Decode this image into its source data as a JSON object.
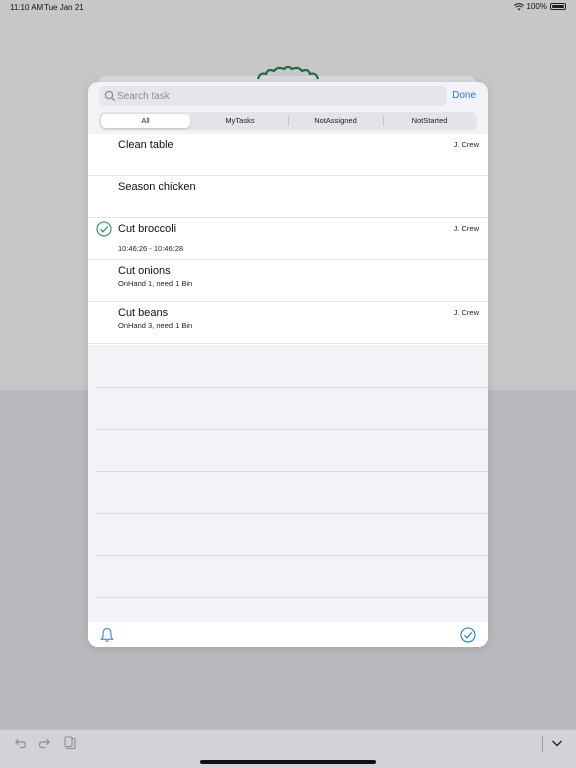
{
  "status_bar": {
    "time": "11:10 AM",
    "date": "Tue Jan 21",
    "battery": "100%"
  },
  "search": {
    "placeholder": "Search task",
    "done_label": "Done"
  },
  "filters": {
    "tabs": [
      "All",
      "MyTasks",
      "NotAssigned",
      "NotStarted"
    ],
    "selected": "All"
  },
  "tasks": [
    {
      "title": "Clean table",
      "subtitle": "",
      "assignee": "J. Crew",
      "completed": false
    },
    {
      "title": "Season chicken",
      "subtitle": "",
      "assignee": "",
      "completed": false
    },
    {
      "title": "Cut broccoli",
      "subtitle": "10:46:26 - 10:46:28",
      "assignee": "J. Crew",
      "completed": true
    },
    {
      "title": "Cut onions",
      "subtitle": "OnHand 1, need 1 Bin",
      "assignee": "",
      "completed": false
    },
    {
      "title": "Cut beans",
      "subtitle": "OnHand 3, need 1 Bin",
      "assignee": "J. Crew",
      "completed": false
    }
  ],
  "icons": {
    "footer_left": "bell-icon",
    "footer_right": "checkmark-circle-icon",
    "toolbar": [
      "undo-icon",
      "redo-icon",
      "clipboard-icon",
      "chevron-down-icon"
    ]
  },
  "colors": {
    "accent": "#1d7ae0",
    "completed_check": "#2e8b57",
    "logo": "#1f6b3a"
  }
}
